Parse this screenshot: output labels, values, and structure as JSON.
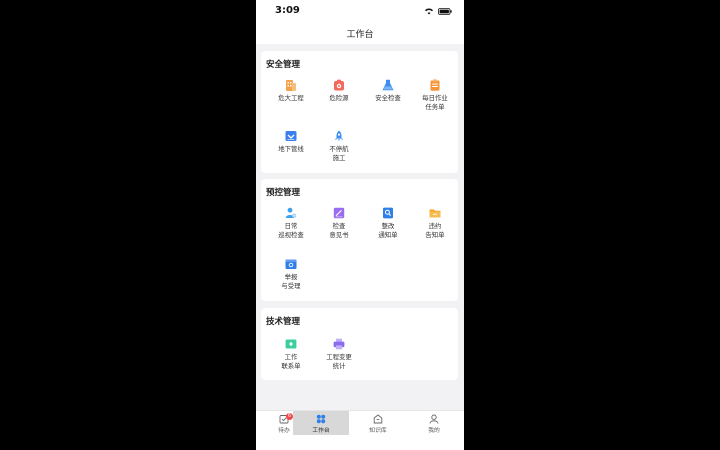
{
  "status": {
    "time": "3:09"
  },
  "navbar": {
    "title": "工作台"
  },
  "sections": [
    {
      "title": "安全管理",
      "items": [
        {
          "label": "危大工程",
          "icon": "building-icon",
          "color": "#f5a04a"
        },
        {
          "label": "危险源",
          "icon": "alarm-icon",
          "color": "#f46a5a"
        },
        {
          "label": "安全检查",
          "icon": "flask-icon",
          "color": "#3a8ef0"
        },
        {
          "label": "每日作业\n任务单",
          "icon": "clipboard-icon",
          "color": "#f5953a"
        },
        {
          "label": "地下管线",
          "icon": "pipe-icon",
          "color": "#3a7ff0"
        },
        {
          "label": "不停航\n施工",
          "icon": "rocket-icon",
          "color": "#3a8ef0"
        }
      ]
    },
    {
      "title": "预控管理",
      "items": [
        {
          "label": "日常\n巡视检查",
          "icon": "inspector-icon",
          "color": "#3aa0f0"
        },
        {
          "label": "检查\n意见书",
          "icon": "document-pen-icon",
          "color": "#9a6cf0"
        },
        {
          "label": "整改\n通知单",
          "icon": "search-doc-icon",
          "color": "#2f7fe8"
        },
        {
          "label": "违约\n告知单",
          "icon": "folder-icon",
          "color": "#f5a623"
        },
        {
          "label": "举报\n与受理",
          "icon": "report-box-icon",
          "color": "#2f7fe8"
        }
      ]
    },
    {
      "title": "技术管理",
      "items": [
        {
          "label": "工作\n联系单",
          "icon": "contact-card-icon",
          "color": "#3ccf9c"
        },
        {
          "label": "工程变更\n统计",
          "icon": "printer-icon",
          "color": "#8b6cf0"
        }
      ]
    }
  ],
  "tabbar": [
    {
      "label": "待办",
      "icon": "todo-icon",
      "badge": "6"
    },
    {
      "label": "工作台",
      "icon": "workbench-icon"
    },
    {
      "label": "知识库",
      "icon": "knowledge-icon"
    },
    {
      "label": "我的",
      "icon": "profile-icon"
    }
  ]
}
